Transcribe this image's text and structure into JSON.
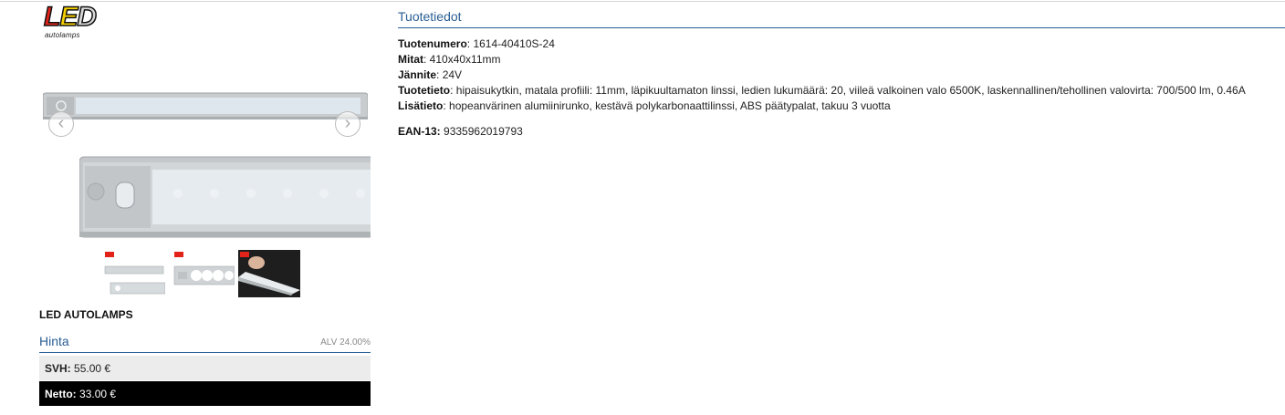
{
  "logo": {
    "letters": [
      "L",
      "E",
      "D"
    ],
    "colors": [
      "#e2231a",
      "#f5d000",
      "#cccccc"
    ],
    "subtitle": "autolamps"
  },
  "gallery": {
    "prev_icon": "chevron-left-icon",
    "next_icon": "chevron-right-icon",
    "selected_thumbnail": 3
  },
  "brand": "LED AUTOLAMPS",
  "price": {
    "title": "Hinta",
    "vat": "ALV 24.00%",
    "svh_label": "SVH:",
    "svh_value": "55.00 €",
    "netto_label": "Netto:",
    "netto_value": "33.00 €"
  },
  "details": {
    "title": "Tuotetiedot",
    "rows": [
      {
        "label": "Tuotenumero",
        "value": "1614-40410S-24"
      },
      {
        "label": "Mitat",
        "value": "410x40x11mm"
      },
      {
        "label": "Jännite",
        "value": "24V"
      },
      {
        "label": "Tuotetieto",
        "value": "hipaisukytkin, matala profiili: 11mm, läpikuultamaton linssi, ledien lukumäärä: 20, viileä valkoinen valo 6500K, laskennallinen/tehollinen valovirta: 700/500 lm, 0.46A"
      },
      {
        "label": "Lisätieto",
        "value": "hopeanvärinen alumiinirunko, kestävä polykarbonaattilinssi, ABS päätypalat, takuu 3 vuotta"
      }
    ],
    "ean_label": "EAN-13:",
    "ean_value": "9335962019793"
  },
  "colors": {
    "accent": "#2a5e94",
    "netto_bg": "#000000",
    "svh_bg": "#ececec"
  }
}
